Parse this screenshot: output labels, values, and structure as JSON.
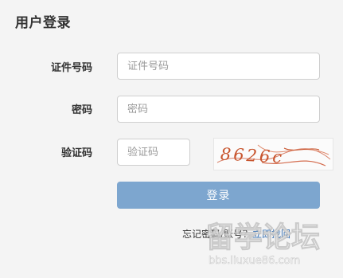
{
  "page": {
    "title": "用户登录"
  },
  "form": {
    "id_label": "证件号码",
    "id_placeholder": "证件号码",
    "password_label": "密码",
    "password_placeholder": "密码",
    "captcha_label": "验证码",
    "captcha_placeholder": "验证码",
    "captcha_text": "8626c",
    "login_label": "登录"
  },
  "footer": {
    "forgot_prefix": "忘记密码/账号？",
    "forgot_action": "立即找回"
  },
  "watermark": {
    "brand": "留学论坛",
    "url": "bbs.liuxue86.com"
  },
  "colors": {
    "background": "#f4f4f4",
    "button": "#7da6cf",
    "link": "#3a73b5",
    "captcha_ink": "#c8552e"
  }
}
